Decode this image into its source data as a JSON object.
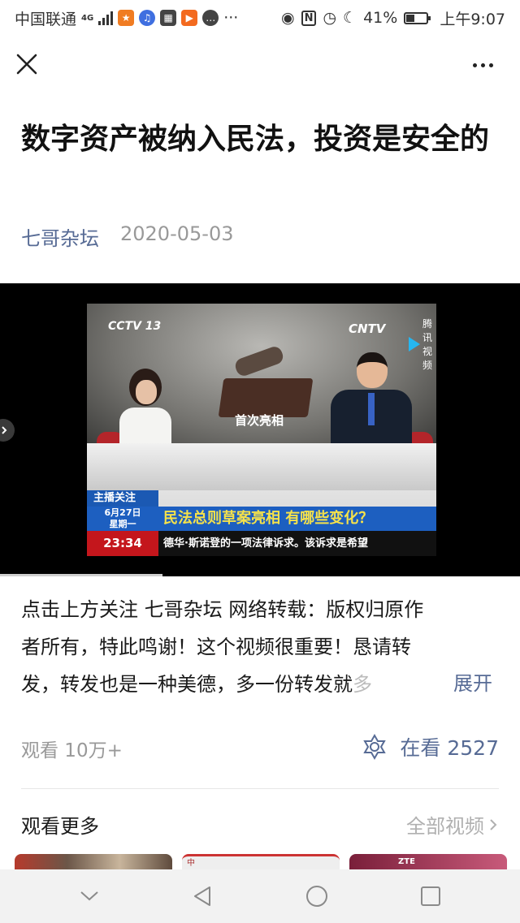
{
  "status_bar": {
    "carrier": "中国联通",
    "network": "4G",
    "battery": "41%",
    "time": "上午9:07"
  },
  "article": {
    "title": "数字资产被纳入民法，投资是安全的",
    "author": "七哥杂坛",
    "date": "2020-05-03"
  },
  "video": {
    "channel_logo": "CCTV 13",
    "cntv_logo": "CNTV",
    "tencent_logo": "腾讯视频",
    "scene_label": "首次亮相",
    "ticker_header": "主播关注",
    "ticker_date": "6月27日",
    "ticker_weekday": "星期一",
    "ticker_headline": "民法总则草案亮相 有哪些变化？",
    "ticker_time": "23:34",
    "ticker_news": "德华·斯诺登的一项法律诉求。该诉求是希望"
  },
  "description": {
    "line1": "点击上方关注 七哥杂坛 网络转载：版权归原作",
    "line2": "者所有，特此鸣谢！这个视频很重要！恳请转",
    "line3": "发，转发也是一种美德，多一份转发就",
    "line3_fade": "多",
    "expand_label": "展开"
  },
  "stats": {
    "views": "观看 10万+",
    "watching": "在看 2527"
  },
  "more": {
    "title": "观看更多",
    "all_label": "全部视频",
    "thumb2_text": "中",
    "thumb3_text": "ZTE"
  },
  "colors": {
    "link": "#576b95",
    "muted": "#999999"
  }
}
